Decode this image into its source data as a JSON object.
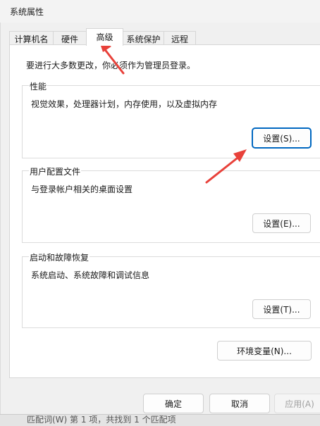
{
  "window": {
    "title": "系统属性"
  },
  "tabs": [
    {
      "label": "计算机名"
    },
    {
      "label": "硬件"
    },
    {
      "label": "高级",
      "active": true
    },
    {
      "label": "系统保护"
    },
    {
      "label": "远程"
    }
  ],
  "admin_note": "要进行大多数更改，你必须作为管理员登录。",
  "performance": {
    "label": "性能",
    "description": "视觉效果，处理器计划，内存使用，以及虚拟内存",
    "button": "设置(S)..."
  },
  "user_profiles": {
    "label": "用户配置文件",
    "description": "与登录帐户相关的桌面设置",
    "button": "设置(E)..."
  },
  "startup_recovery": {
    "label": "启动和故障恢复",
    "description": "系统启动、系统故障和调试信息",
    "button": "设置(T)..."
  },
  "env_button": "环境变量(N)...",
  "footer": {
    "ok": "确定",
    "cancel": "取消",
    "apply": "应用(A)"
  },
  "background_status": "匹配词(W)     第 1 项，共找到 1 个匹配项",
  "annotation_color": "#e8413a"
}
